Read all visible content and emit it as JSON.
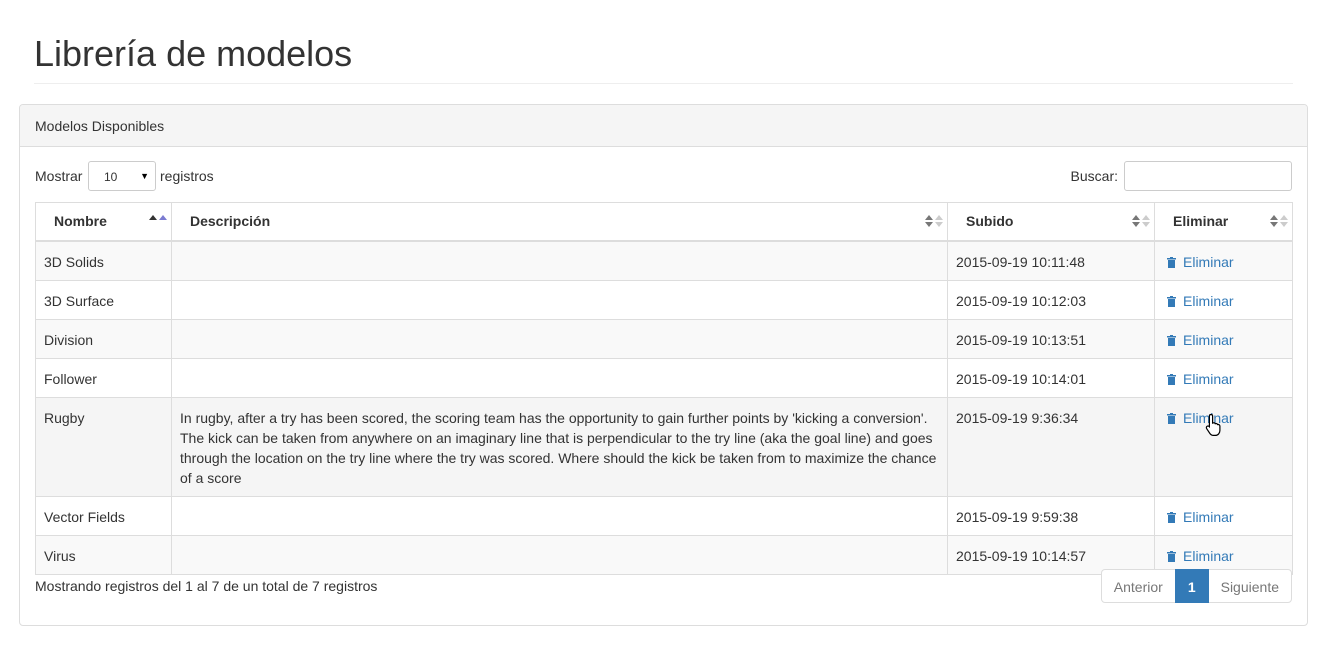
{
  "page": {
    "title": "Librería de modelos"
  },
  "panel": {
    "heading": "Modelos Disponibles"
  },
  "controls": {
    "length_prefix": "Mostrar",
    "length_value": "10",
    "length_suffix": "registros",
    "search_label": "Buscar:",
    "search_value": ""
  },
  "table": {
    "columns": [
      "Nombre",
      "Descripción",
      "Subido",
      "Eliminar"
    ],
    "sorted_column": "Nombre",
    "rows": [
      {
        "nombre": "3D Solids",
        "descripcion": "",
        "subido": "2015-09-19 10:11:48",
        "eliminar": "Eliminar"
      },
      {
        "nombre": "3D Surface",
        "descripcion": "",
        "subido": "2015-09-19 10:12:03",
        "eliminar": "Eliminar"
      },
      {
        "nombre": "Division",
        "descripcion": "",
        "subido": "2015-09-19 10:13:51",
        "eliminar": "Eliminar"
      },
      {
        "nombre": "Follower",
        "descripcion": "",
        "subido": "2015-09-19 10:14:01",
        "eliminar": "Eliminar"
      },
      {
        "nombre": "Rugby",
        "descripcion": "In rugby, after a try has been scored, the scoring team has the opportunity to gain further points by 'kicking a conversion'. The kick can be taken from anywhere on an imaginary line that is perpendicular to the try line (aka the goal line) and goes through the location on the try line where the try was scored. Where should the kick be taken from to maximize the chance of a score",
        "subido": "2015-09-19 9:36:34",
        "eliminar": "Eliminar"
      },
      {
        "nombre": "Vector Fields",
        "descripcion": "",
        "subido": "2015-09-19 9:59:38",
        "eliminar": "Eliminar"
      },
      {
        "nombre": "Virus",
        "descripcion": "",
        "subido": "2015-09-19 10:14:57",
        "eliminar": "Eliminar"
      }
    ]
  },
  "footer": {
    "info": "Mostrando registros del 1 al 7 de un total de 7 registros",
    "pagination": {
      "previous": "Anterior",
      "current": "1",
      "next": "Siguiente"
    }
  },
  "colors": {
    "link": "#337ab7",
    "active_page": "#337ab7",
    "border": "#dddddd",
    "panel_heading_bg": "#f5f5f5"
  },
  "icons": {
    "delete": "trash-icon",
    "cursor": "hand-pointer-icon"
  }
}
